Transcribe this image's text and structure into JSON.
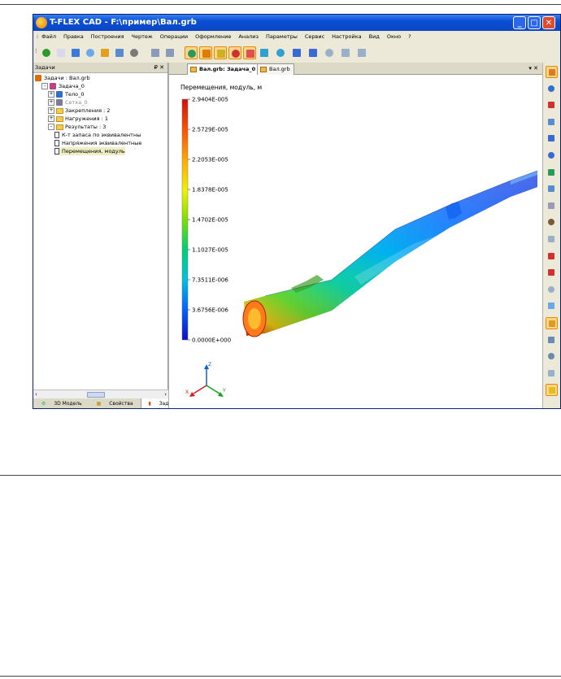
{
  "window": {
    "title": "T-FLEX CAD - F:\\пример\\Вал.grb",
    "controls": {
      "minimize": "_",
      "maximize": "□",
      "close": "✕"
    }
  },
  "menubar": [
    "Файл",
    "Правка",
    "Построения",
    "Чертеж",
    "Операции",
    "Оформление",
    "Анализ",
    "Параметры",
    "Сервис",
    "Настройка",
    "Вид",
    "Окно",
    "?"
  ],
  "toolbar": {
    "icons": [
      "check-icon",
      "new-document-icon",
      "cube-icon",
      "window-icon",
      "tools-icon",
      "print-icon",
      "printer-icon",
      "undo-icon",
      "redo-icon",
      "solid-icon",
      "model-icon",
      "sheet-icon",
      "stress-icon",
      "force-icon",
      "mesh-icon",
      "result-icon",
      "settings-icon",
      "report-icon",
      "page-icon",
      "table-icon",
      "export-icon"
    ]
  },
  "left_panel": {
    "title": "Задачи",
    "pin": "₽ ✕",
    "tree": [
      {
        "label": "Задачи : Вал.grb",
        "depth": 0,
        "kind": "root"
      },
      {
        "label": "Задача_0",
        "depth": 1,
        "kind": "task",
        "expander": "-"
      },
      {
        "label": "Тело_0",
        "depth": 2,
        "kind": "body",
        "expander": "+"
      },
      {
        "label": "Сетка_0",
        "depth": 2,
        "kind": "mesh",
        "expander": "+"
      },
      {
        "label": "Закрепления : 2",
        "depth": 2,
        "kind": "folder",
        "expander": "+"
      },
      {
        "label": "Нагружения : 1",
        "depth": 2,
        "kind": "folder",
        "expander": "+"
      },
      {
        "label": "Результаты : 3",
        "depth": 2,
        "kind": "folder",
        "expander": "-"
      },
      {
        "label": "К-т запаса по эквивалентны",
        "depth": 3,
        "kind": "doc"
      },
      {
        "label": "Напряжения эквивалентные",
        "depth": 3,
        "kind": "doc"
      },
      {
        "label": "Перемещения, модуль",
        "depth": 3,
        "kind": "doc",
        "selected": true
      }
    ],
    "tabs": [
      "3D Модель",
      "Свойства",
      "Задачи"
    ],
    "active_tab": "Задачи"
  },
  "document": {
    "tabs": [
      "Вал.grb: Задача_0",
      "Вал.grb"
    ],
    "active_tab": "Вал.grb: Задача_0",
    "tab_controls": "▾ ✕"
  },
  "legend": {
    "title": "Перемещения, модуль, м",
    "values": [
      "2.9404E-005",
      "2.5729E-005",
      "2.2053E-005",
      "1.8378E-005",
      "1.4702E-005",
      "1.1027E-005",
      "7.3511E-006",
      "3.6756E-006",
      "0.0000E+000"
    ],
    "colors": [
      "#d01010",
      "#ff5a00",
      "#ffb000",
      "#f0f000",
      "#7ee000",
      "#00d070",
      "#00c0e0",
      "#0066ff",
      "#1010c8"
    ]
  },
  "axes": {
    "x": "X",
    "y": "Y",
    "z": "Z"
  },
  "right_toolbar": {
    "icons": [
      "rotate-icon",
      "zoom-icon",
      "pan-icon",
      "zoom-window-icon",
      "fit-icon",
      "fit-all-icon",
      "zoom-in-icon",
      "zoom-out-icon",
      "view-icon",
      "light-icon",
      "section-icon",
      "check-model-icon",
      "check-mesh-icon",
      "hide-icon",
      "front-view-icon",
      "iso-view-icon",
      "wire-view-icon",
      "shade-view-icon",
      "hidden-view-icon",
      "color-view-icon"
    ],
    "active": [
      "rotate-icon",
      "iso-view-icon",
      "color-view-icon"
    ]
  }
}
